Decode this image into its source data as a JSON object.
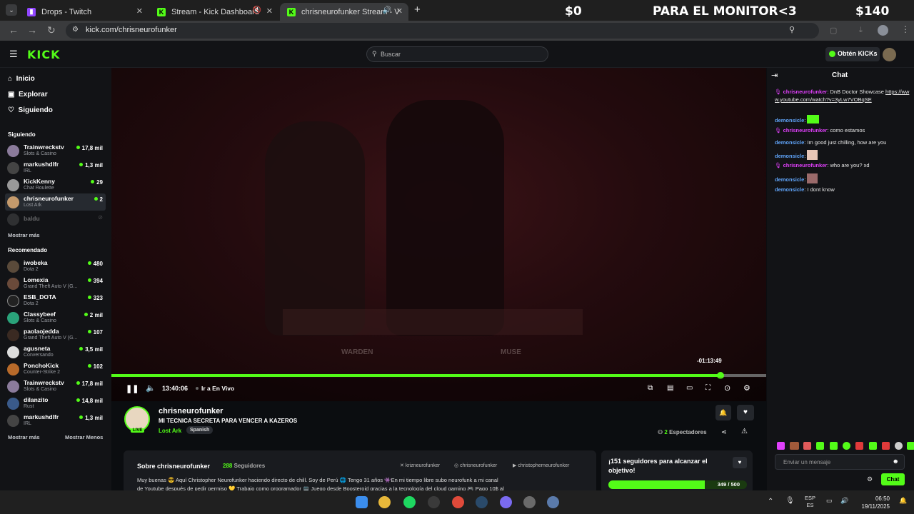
{
  "browser": {
    "tabs": [
      {
        "title": "Drops - Twitch",
        "fav": "twitch-icon",
        "color": "#9146ff"
      },
      {
        "title": "Stream - Kick Dashboard",
        "fav": "kick-icon",
        "color": "#53fc18"
      },
      {
        "title": "chrisneurofunker Stream - V",
        "fav": "kick-icon",
        "color": "#53fc18"
      }
    ],
    "url": "kick.com/chrisneurofunker",
    "overlay": {
      "left": "$0",
      "center": "PARA EL MONITOR<3",
      "right": "$140"
    }
  },
  "kick": {
    "logo": "KICK",
    "search_placeholder": "Buscar",
    "get_kicks": "Obtén KICKs"
  },
  "sidebar": {
    "nav": [
      "Inicio",
      "Explorar",
      "Siguiendo"
    ],
    "following_title": "Siguiendo",
    "following": [
      {
        "name": "Trainwreckstv",
        "cat": "Slots & Casino",
        "count": "17,8 mil"
      },
      {
        "name": "markushdlfr",
        "cat": "IRL",
        "count": "1,3 mil"
      },
      {
        "name": "KickKenny",
        "cat": "Chat Roulette",
        "count": "29"
      },
      {
        "name": "chrisneurofunker",
        "cat": "Lost Ark",
        "count": "2"
      },
      {
        "name": "baldu",
        "cat": "",
        "count": ""
      }
    ],
    "show_more": "Mostrar más",
    "recommended_title": "Recomendado",
    "recommended": [
      {
        "name": "iwobeka",
        "cat": "Dota 2",
        "count": "480"
      },
      {
        "name": "Lomexia",
        "cat": "Grand Theft Auto V (G...",
        "count": "394"
      },
      {
        "name": "ESB_DOTA",
        "cat": "Dota 2",
        "count": "323"
      },
      {
        "name": "Classybeef",
        "cat": "Slots & Casino",
        "count": "2 mil"
      },
      {
        "name": "paolaojedda",
        "cat": "Grand Theft Auto V (G...",
        "count": "107"
      },
      {
        "name": "agusneta",
        "cat": "Conversando",
        "count": "3,5 mil"
      },
      {
        "name": "PonchoKick",
        "cat": "Counter-Strike 2",
        "count": "102"
      },
      {
        "name": "Trainwreckstv",
        "cat": "Slots & Casino",
        "count": "17,8 mil"
      },
      {
        "name": "dilanzito",
        "cat": "Rust",
        "count": "14,8 mil"
      },
      {
        "name": "markushdlfr",
        "cat": "IRL",
        "count": "1,3 mil"
      }
    ],
    "show_more2": "Mostrar más",
    "show_less": "Mostrar Menos"
  },
  "player": {
    "time": "13:40:06",
    "go_live": "Ir a En Vivo",
    "remaining": "-01:13:49",
    "progress": 0.93,
    "overlay_texts": [
      "WARDEN",
      "MUSE"
    ]
  },
  "stream": {
    "channel": "chrisneurofunker",
    "title": "MI TECNICA SECRETA PARA VENCER A KAZEROS",
    "category": "Lost Ark",
    "language": "Spanish",
    "live": "LIVE",
    "viewers": "2",
    "viewers_label": "Espectadores"
  },
  "about": {
    "title": "Sobre chrisneurofunker",
    "followers": "288",
    "followers_label": "Seguidores",
    "socials": [
      "krizneurofunker",
      "chrisneurofunker",
      "christopherneurofunker"
    ],
    "desc1": "Muy buenas 😎 Aquí Christopher Neurofunker haciendo directo de chill. Soy de Perú 🌐 Tengo 31 años 👾En mi tiempo libre subo neurofunk a mi canal",
    "desc2": "de Youtube después de pedir permiso 💛 Trabajo como programador 💻 Juego desde Boosteroid gracias a la tecnología del cloud gaming 🎮 Pago 10$ al"
  },
  "goal": {
    "text": "¡151 seguidores para alcanzar el objetivo!",
    "value": "349 / 500",
    "fraction": 0.698
  },
  "chat": {
    "title": "Chat",
    "messages": [
      {
        "user": "chrisneurofunker",
        "text": ": DnB Doctor Showcase",
        "link": "https://www.youtube.com/watch?v=3yLw7VOBqSE",
        "color": "#e040fb"
      },
      {
        "user": "demonsicle",
        "text": ": ",
        "color": "#60a5fa",
        "emote": true
      },
      {
        "user": "chrisneurofunker",
        "text": ": como estamos",
        "color": "#e040fb"
      },
      {
        "user": "demonsicle",
        "text": ": Im good just chilling, how are you",
        "color": "#60a5fa"
      },
      {
        "user": "demonsicle",
        "text": ": ",
        "color": "#60a5fa",
        "emote": true
      },
      {
        "user": "chrisneurofunker",
        "text": ": who are you? xd",
        "color": "#e040fb"
      },
      {
        "user": "demonsicle",
        "text": ": ",
        "color": "#60a5fa",
        "emote": true
      },
      {
        "user": "demonsicle",
        "text": ": I dont know",
        "color": "#60a5fa"
      }
    ],
    "placeholder": "Enviar un mensaje",
    "send": "Chat"
  },
  "taskbar": {
    "lang1": "ESP",
    "lang2": "ES",
    "time": "06:50",
    "date": "19/11/2025"
  }
}
